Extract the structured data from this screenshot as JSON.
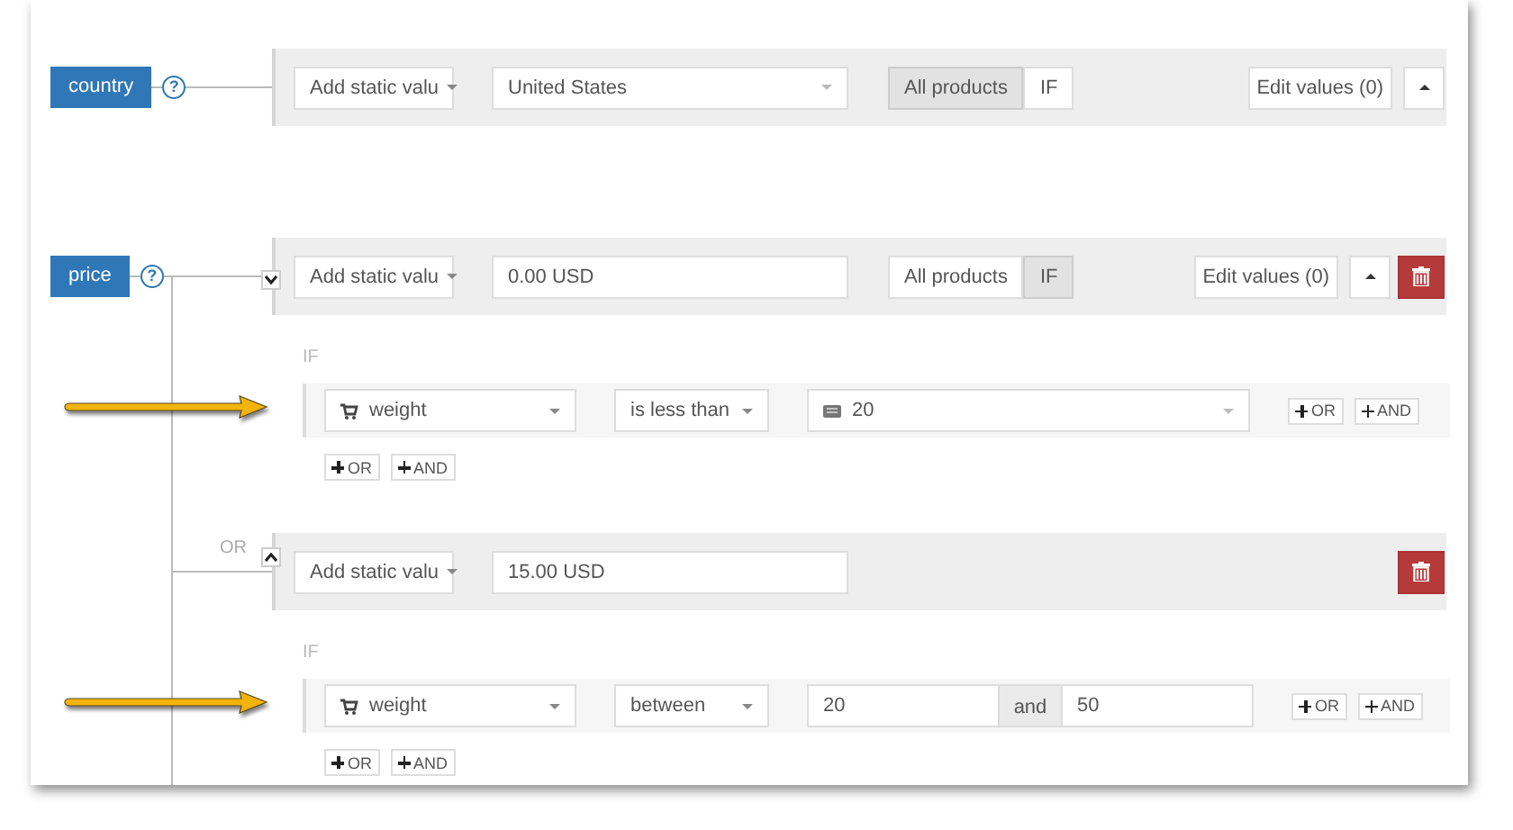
{
  "attributes": [
    {
      "label": "country",
      "help": "?",
      "rules": [
        {
          "source": "Add static valu",
          "value": "United States",
          "kind": "select",
          "scope": [
            {
              "label": "All products",
              "selected": true
            },
            {
              "label": "IF",
              "selected": false
            }
          ],
          "edit_values": "Edit values (0)",
          "collapse_button": true,
          "deletable": false
        }
      ]
    },
    {
      "label": "price",
      "help": "?",
      "rules": [
        {
          "expanded": true,
          "source": "Add static valu",
          "value": "0.00 USD",
          "kind": "input",
          "scope": [
            {
              "label": "All products",
              "selected": false
            },
            {
              "label": "IF",
              "selected": true
            }
          ],
          "edit_values": "Edit values (0)",
          "collapse_button": true,
          "deletable": true,
          "conditions": {
            "heading": "IF",
            "rows": [
              {
                "attribute": "weight",
                "operator": "is less than",
                "kind": "single",
                "value": "20",
                "or_button": "OR",
                "and_button": "AND"
              }
            ],
            "or_button": "OR",
            "and_button": "AND"
          }
        },
        {
          "connector": "OR",
          "expanded": false,
          "source": "Add static valu",
          "value": "15.00 USD",
          "kind": "input",
          "collapse_button": false,
          "deletable": true,
          "conditions": {
            "heading": "IF",
            "rows": [
              {
                "attribute": "weight",
                "operator": "between",
                "kind": "range",
                "from": "20",
                "joiner": "and",
                "to": "50",
                "or_button": "OR",
                "and_button": "AND"
              }
            ],
            "or_button": "OR",
            "and_button": "AND"
          }
        }
      ]
    }
  ]
}
